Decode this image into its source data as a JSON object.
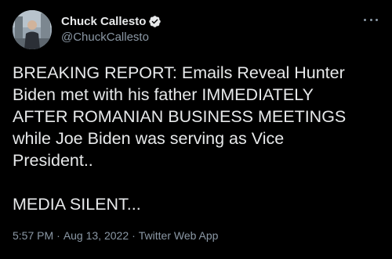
{
  "author": {
    "display_name": "Chuck Callesto",
    "handle": "@ChuckCallesto",
    "verified_icon": "verified-badge-icon",
    "avatar_icon": "avatar-photo"
  },
  "more_icon": "more-options-icon",
  "tweet": {
    "text": "BREAKING REPORT: Emails Reveal Hunter\nBiden met with his father IMMEDIATELY\nAFTER ROMANIAN BUSINESS MEETINGS\nwhile Joe Biden was serving as Vice\nPresident..\n\nMEDIA SILENT..."
  },
  "meta": {
    "time": "5:57 PM",
    "separator": "·",
    "date": "Aug 13, 2022",
    "source": "Twitter Web App"
  },
  "colors": {
    "background": "#000000",
    "text_primary": "#e7e9ea",
    "text_secondary": "#8b98a5",
    "verified_blue": "#1d9bf0"
  }
}
